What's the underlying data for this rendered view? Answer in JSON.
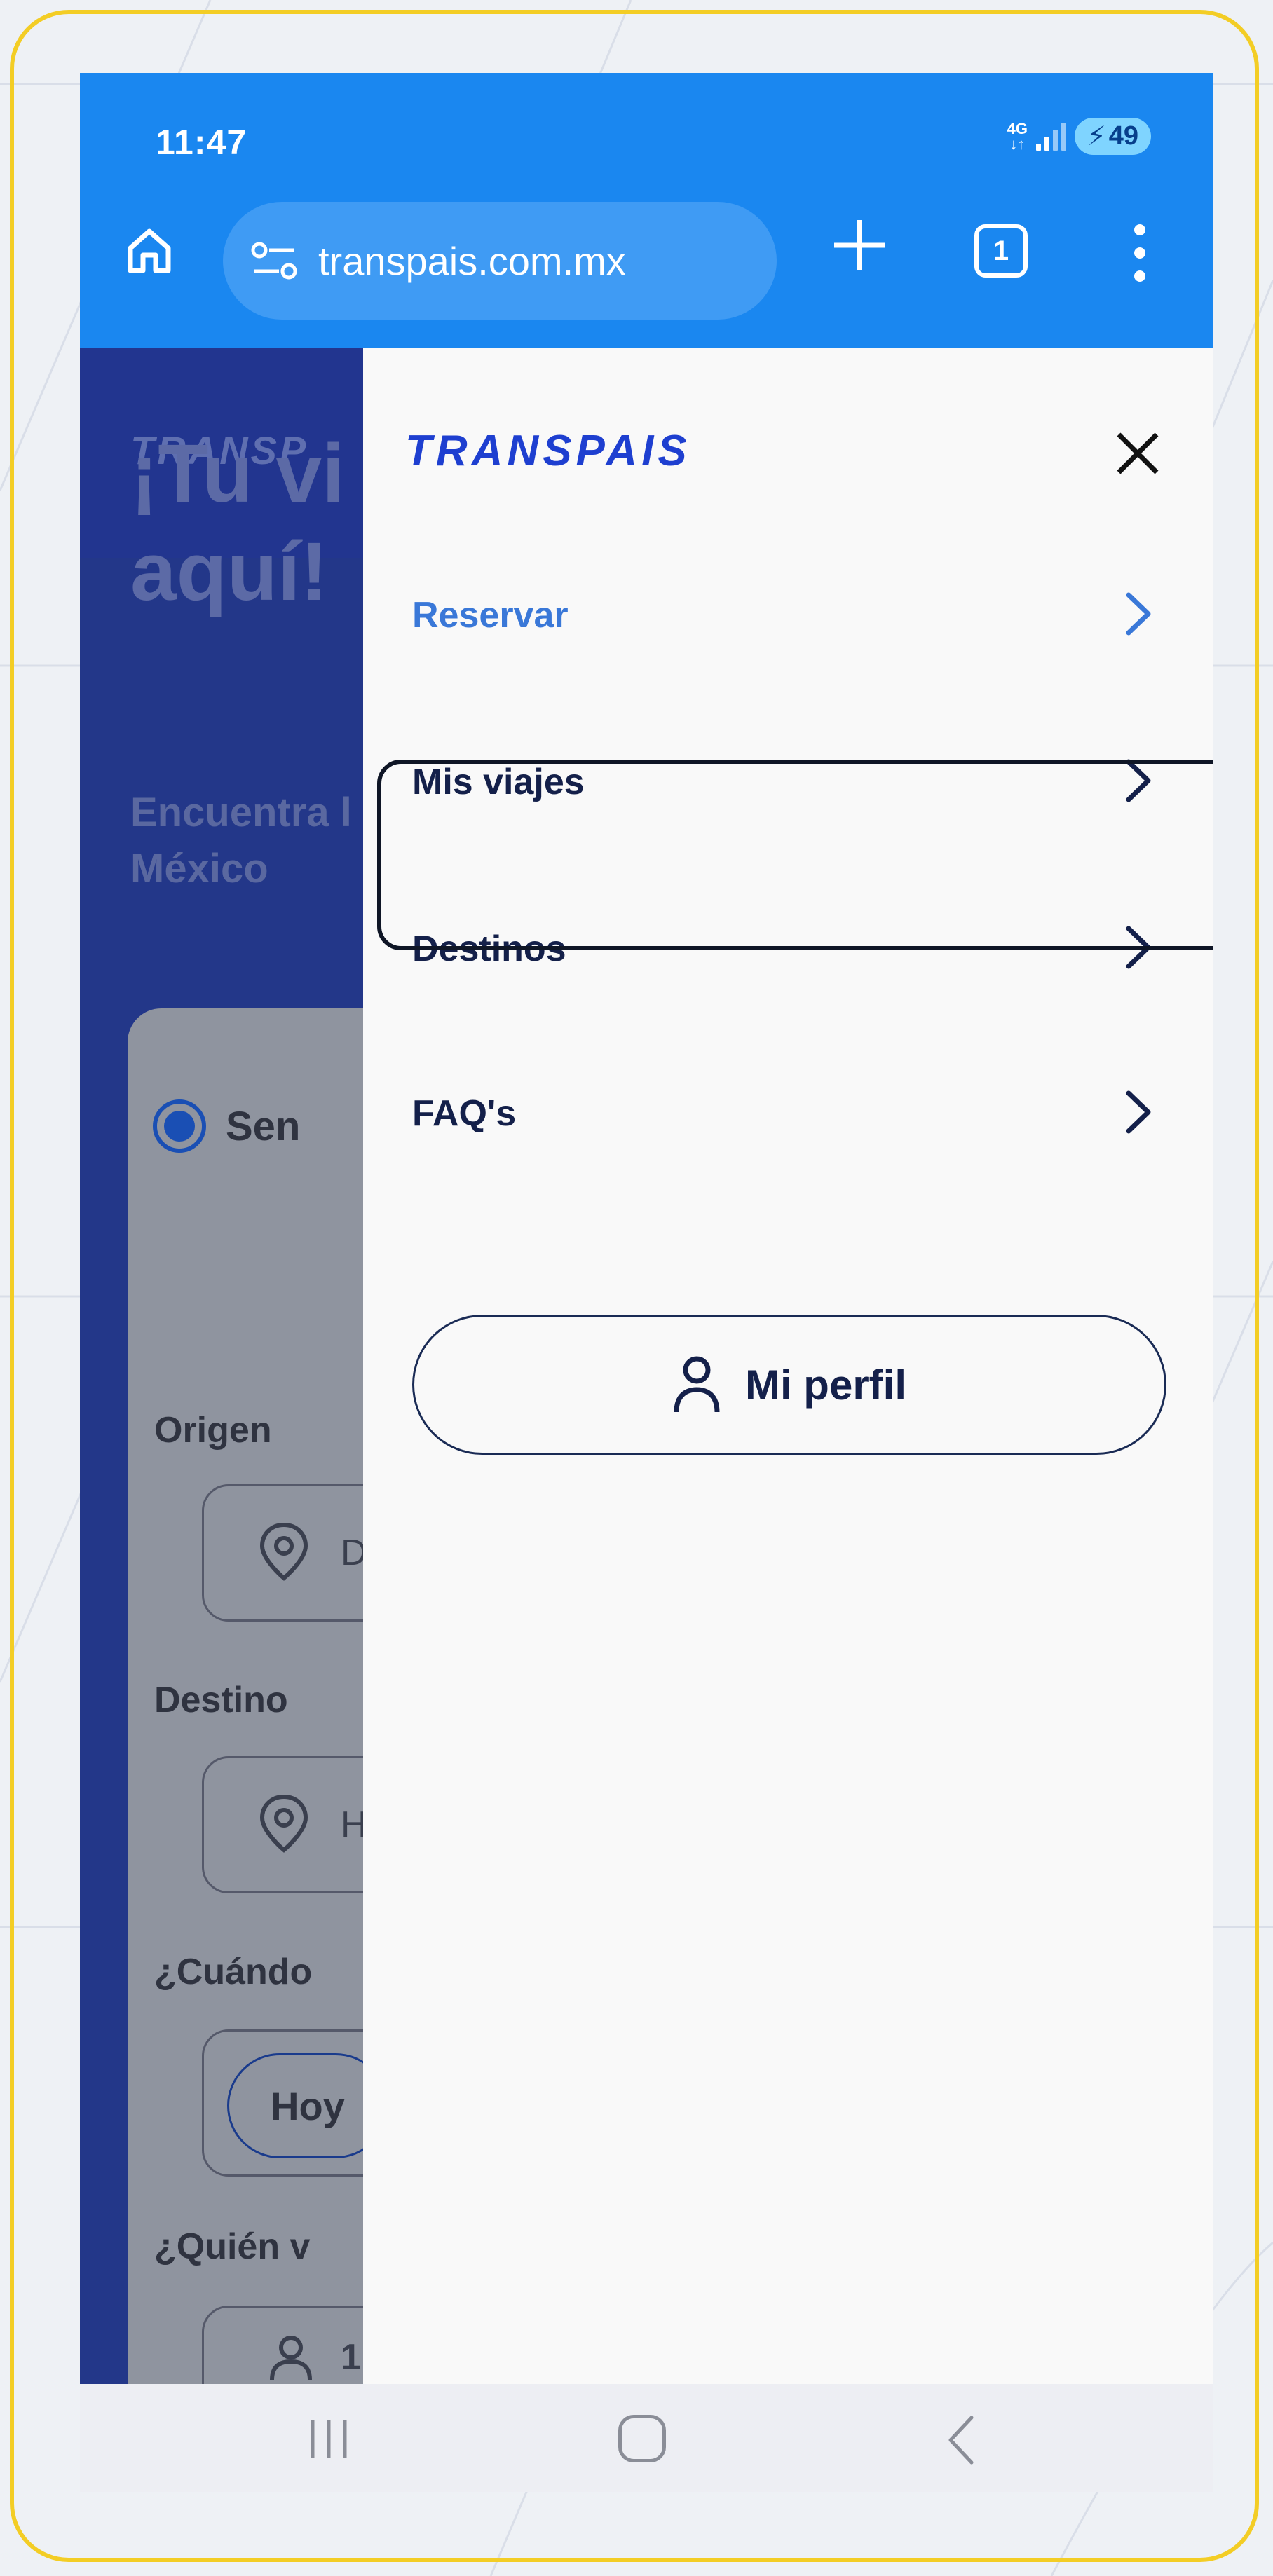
{
  "status_bar": {
    "time": "11:47",
    "network": "4G",
    "battery": "49"
  },
  "browser": {
    "url": "transpais.com.mx",
    "tab_count": "1"
  },
  "background_page": {
    "logo": "TRANSP",
    "hero_line1": "¡Tu vi",
    "hero_line2": "aquí!",
    "hero_sub_line1": "Encuentra l",
    "hero_sub_line2": "México",
    "trip_option": "Sen",
    "origin_label": "Origen",
    "origin_value": "D",
    "destination_label": "Destino",
    "destination_value": "H",
    "when_label": "¿Cuándo",
    "today_button": "Hoy",
    "who_label": "¿Quién v",
    "passengers_value": "1"
  },
  "drawer": {
    "logo": "TRANSPAIS",
    "items": [
      {
        "label": "Reservar",
        "color": "#3a78d8"
      },
      {
        "label": "Mis viajes",
        "color": "#14204a"
      },
      {
        "label": "Destinos",
        "color": "#14204a"
      },
      {
        "label": "FAQ's",
        "color": "#14204a"
      }
    ],
    "profile_button": "Mi perfil"
  },
  "colors": {
    "brand_blue": "#1e3fd0",
    "chrome_blue": "#1a87f0",
    "highlight": "#f3cd25"
  }
}
